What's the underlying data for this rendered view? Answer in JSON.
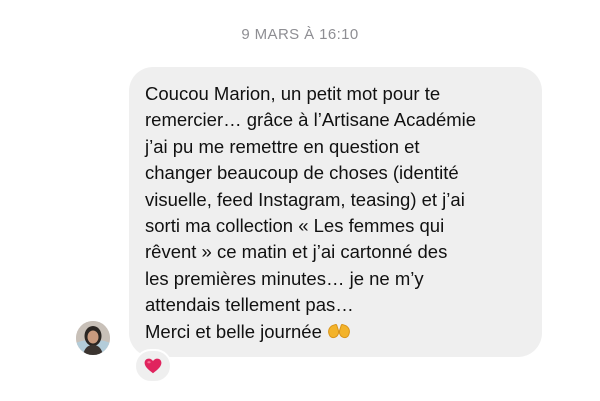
{
  "thread": {
    "timestamp": "9 MARS À 16:10"
  },
  "message": {
    "lines": [
      "Coucou Marion, un petit mot pour te",
      "remercier… grâce à l’Artisane Académie",
      "j’ai pu me remettre en question et",
      "changer beaucoup de choses (identité",
      "visuelle, feed Instagram, teasing) et j’ai",
      "sorti ma collection « Les femmes qui",
      "rêvent » ce matin et j’ai cartonné des",
      "les premières minutes… je ne m’y",
      "attendais tellement pas…",
      "Merci et belle journée"
    ],
    "trailing_emoji": "heart-hands-icon",
    "reaction": "heart-icon",
    "bubble_color": "#efefef",
    "reaction_color": "#e0245e"
  },
  "sender": {
    "avatar": "avatar"
  }
}
